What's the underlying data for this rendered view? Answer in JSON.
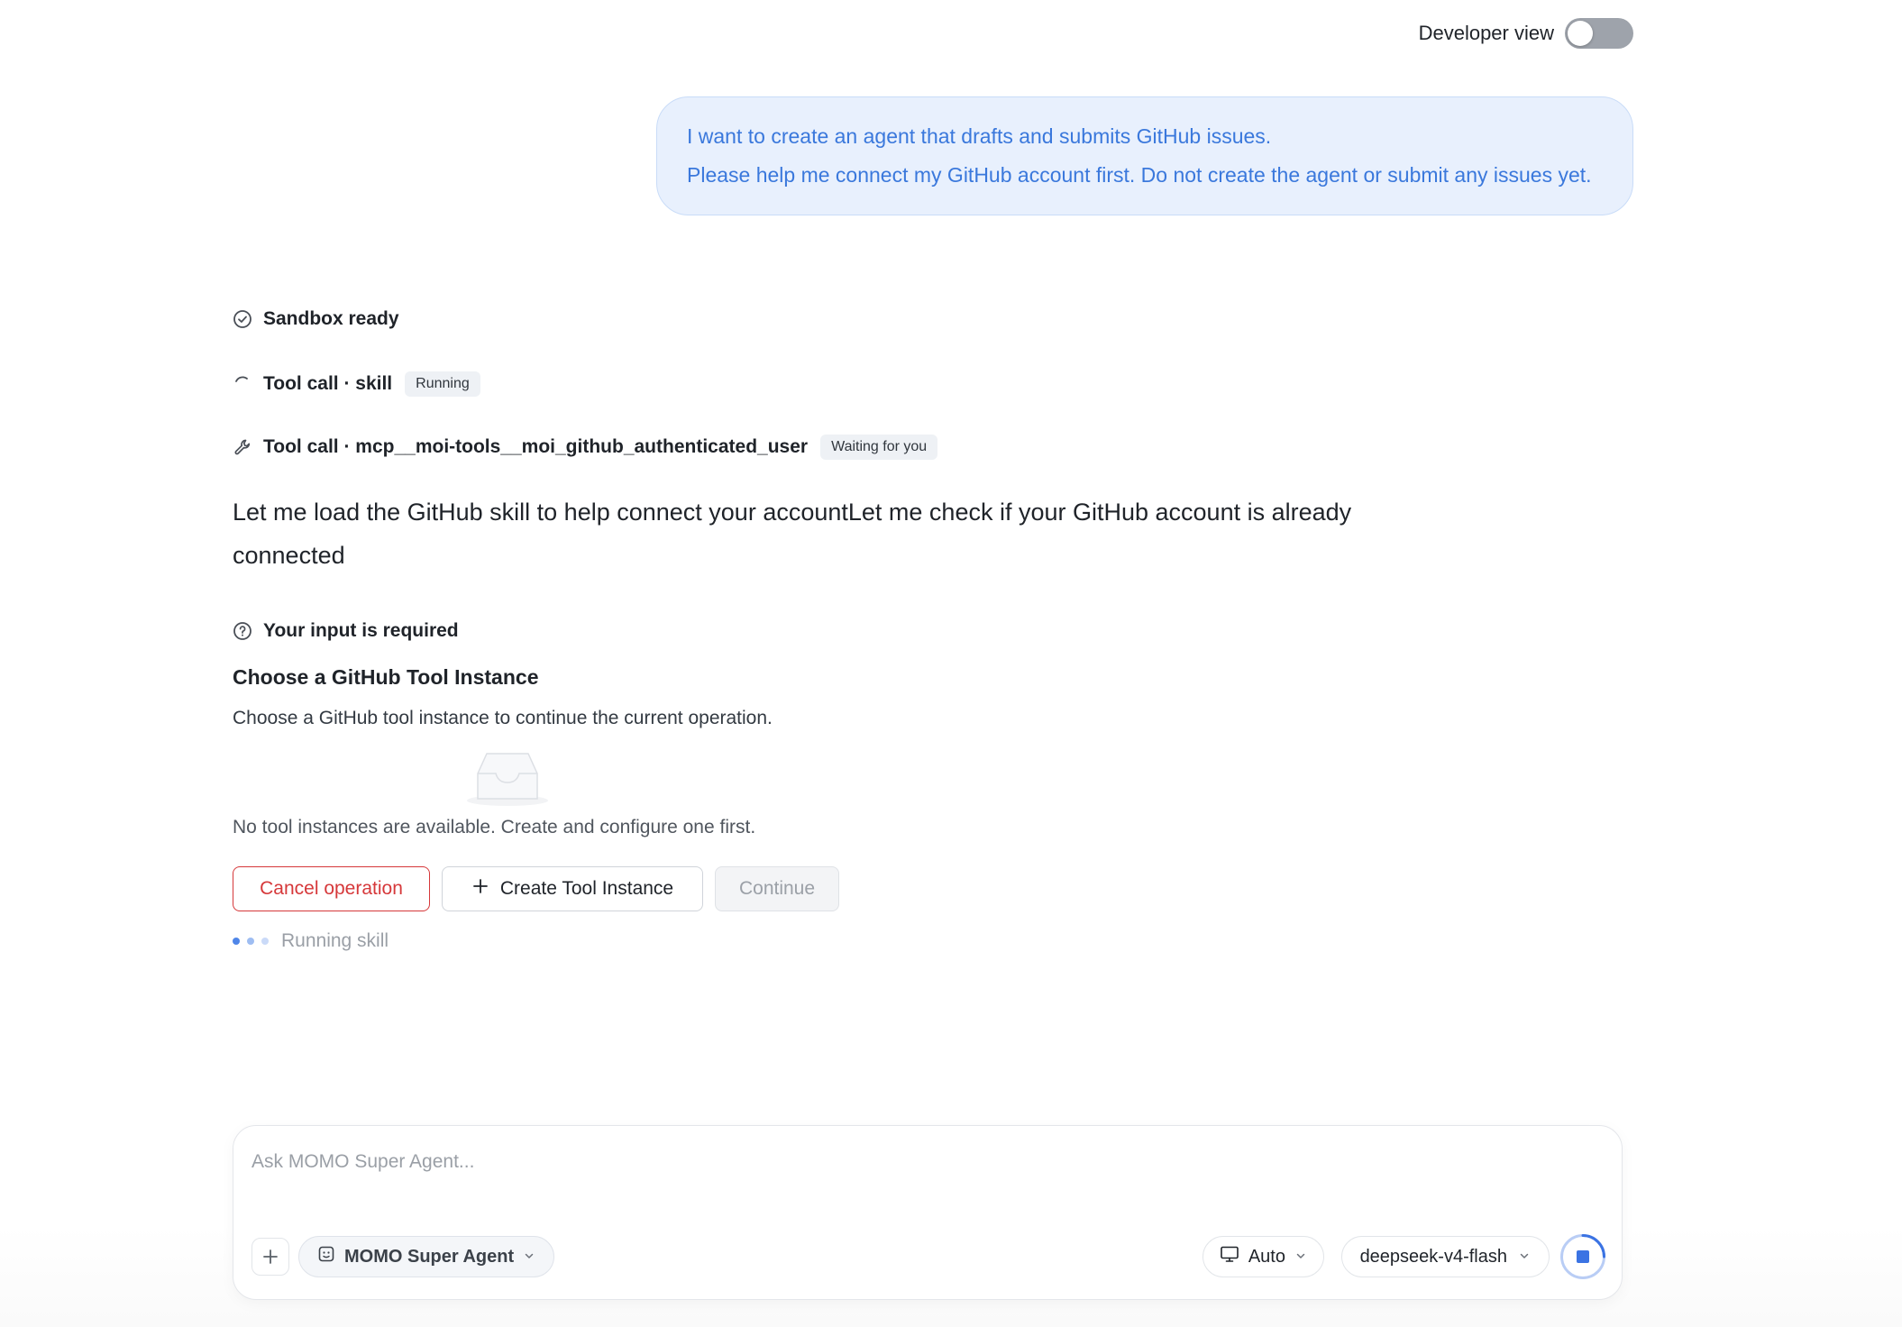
{
  "header": {
    "developer_view_label": "Developer view",
    "developer_view_on": false
  },
  "user_message": {
    "lines": [
      "I want to create an agent that drafts and submits GitHub issues.",
      "Please help me connect my GitHub account first. Do not create the agent or submit any issues yet."
    ]
  },
  "steps": [
    {
      "icon": "check-circle-icon",
      "label": "Sandbox ready",
      "badge": ""
    },
    {
      "icon": "spinner-icon",
      "label": "Tool call · skill",
      "badge": "Running"
    },
    {
      "icon": "wrench-icon",
      "label": "Tool call · mcp__moi-tools__moi_github_authenticated_user",
      "badge": "Waiting for you"
    },
    {
      "icon": "question-circle-icon",
      "label": "Your input is required",
      "badge": ""
    }
  ],
  "assistant_message": "Let me load the GitHub skill to help connect your accountLet me check if your GitHub account is already connected",
  "prompt": {
    "title": "Choose a GitHub Tool Instance",
    "description": "Choose a GitHub tool instance to continue the current operation.",
    "empty_text": "No tool instances are available. Create and configure one first.",
    "cancel_label": "Cancel operation",
    "create_label": "Create Tool Instance",
    "continue_label": "Continue"
  },
  "status": {
    "running_text": "Running skill"
  },
  "composer": {
    "placeholder": "Ask MOMO Super Agent...",
    "agent_label": "MOMO Super Agent",
    "mode_label": "Auto",
    "model_label": "deepseek-v4-flash"
  },
  "colors": {
    "accent": "#3b73e3",
    "danger": "#d6383a",
    "bubble_bg": "#e8f0fd",
    "bubble_text": "#3a78dc"
  }
}
